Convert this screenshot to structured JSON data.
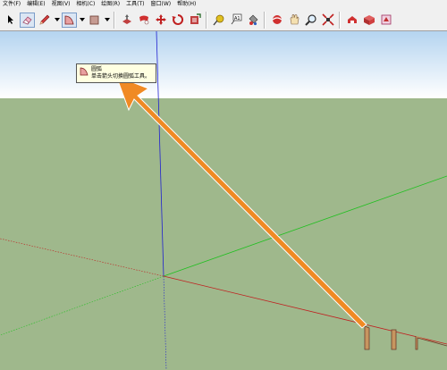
{
  "menu": [
    "文件(F)",
    "编辑(E)",
    "视图(V)",
    "相机(C)",
    "绘图(R)",
    "工具(T)",
    "窗口(W)",
    "帮助(H)"
  ],
  "toolbar": {
    "tools": [
      {
        "name": "select",
        "icon": "arrow-cursor-icon"
      },
      {
        "name": "eraser",
        "icon": "eraser-icon",
        "active": true
      },
      {
        "name": "pencil",
        "icon": "pencil-icon"
      },
      {
        "name": "arc",
        "icon": "arc-icon",
        "active": true
      },
      {
        "name": "rectangle",
        "icon": "rectangle-icon"
      },
      {
        "name": "push-pull",
        "icon": "push-pull-icon"
      },
      {
        "name": "follow-me",
        "icon": "follow-me-icon"
      },
      {
        "name": "move",
        "icon": "move-icon"
      },
      {
        "name": "rotate",
        "icon": "rotate-icon"
      },
      {
        "name": "offset",
        "icon": "offset-icon"
      },
      {
        "name": "tape-measure",
        "icon": "tape-measure-icon"
      },
      {
        "name": "text",
        "icon": "text-icon"
      },
      {
        "name": "paint-bucket",
        "icon": "paint-bucket-icon"
      },
      {
        "name": "orbit",
        "icon": "orbit-icon"
      },
      {
        "name": "pan",
        "icon": "pan-icon"
      },
      {
        "name": "zoom",
        "icon": "zoom-icon"
      },
      {
        "name": "zoom-extents",
        "icon": "zoom-extents-icon"
      },
      {
        "name": "warehouse",
        "icon": "warehouse-icon"
      },
      {
        "name": "components",
        "icon": "components-icon"
      },
      {
        "name": "extension",
        "icon": "extension-icon"
      }
    ]
  },
  "tooltip": {
    "title": "圆弧",
    "description": "单击箭头切换圆弧工具。"
  },
  "colors": {
    "sky_top": "#b4d4f0",
    "sky_bottom": "#ffffff",
    "ground": "#9fb88c",
    "axis_blue": "#2020d0",
    "axis_green": "#20c020",
    "axis_red": "#c02020",
    "arrow": "#f08a24"
  }
}
